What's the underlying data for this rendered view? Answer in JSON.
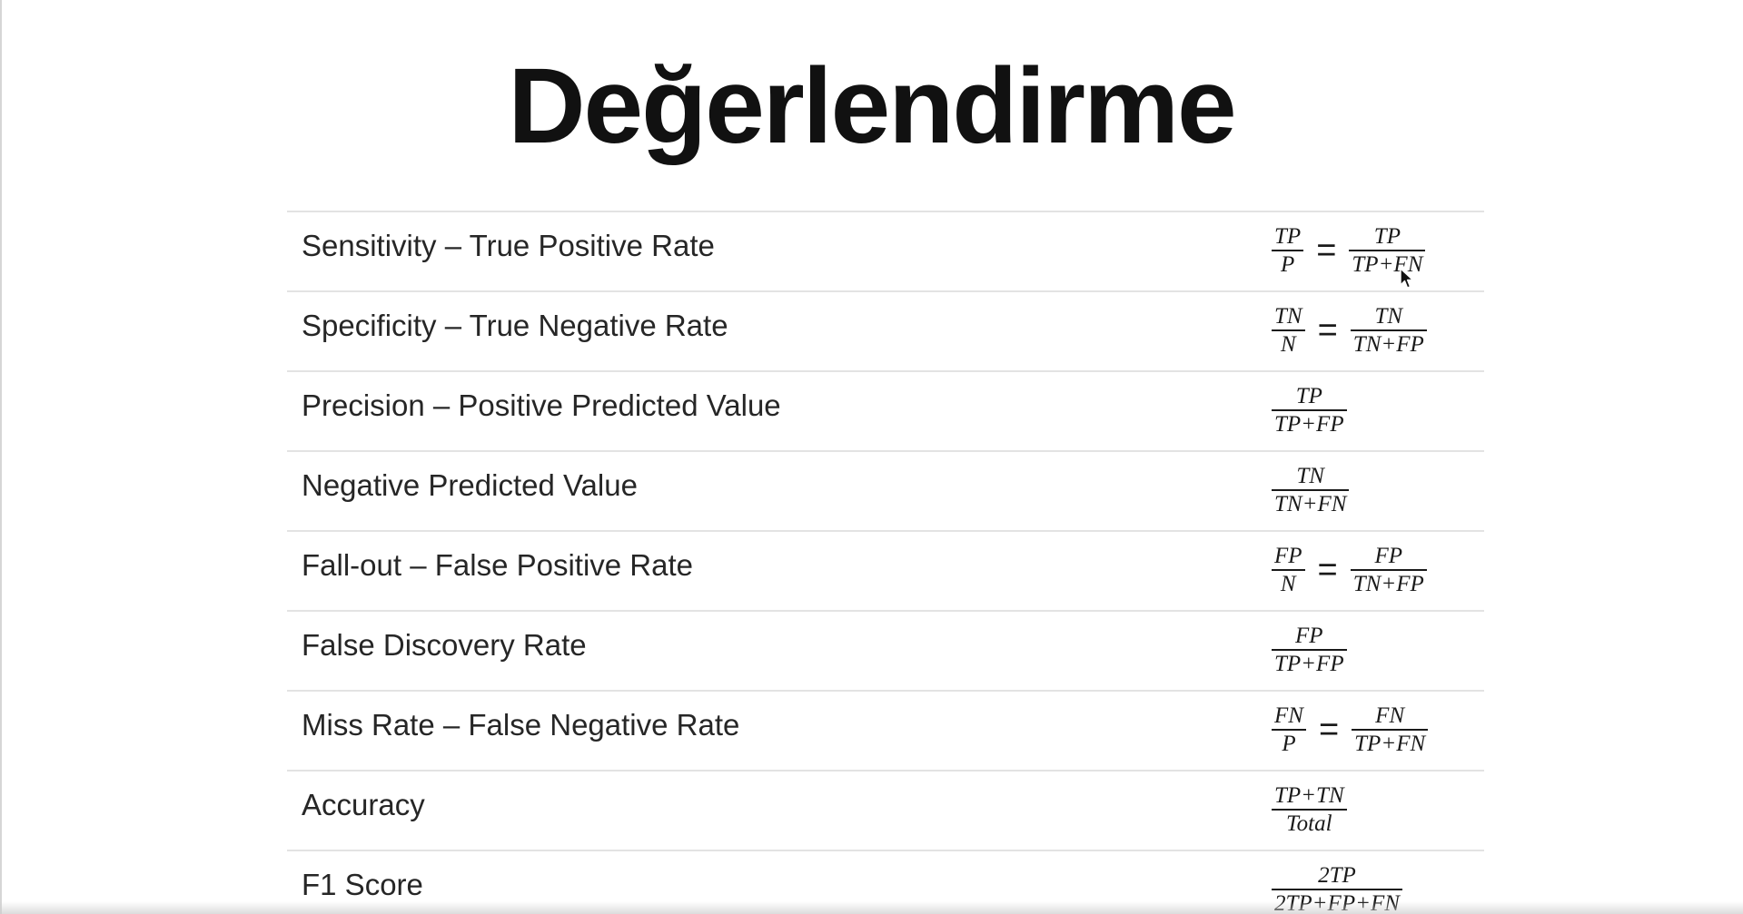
{
  "title": "Değerlendirme",
  "metrics": [
    {
      "name": "Sensitivity – True Positive Rate",
      "f1_num": "TP",
      "f1_den": "P",
      "f2_num": "TP",
      "f2_den": "TP+FN"
    },
    {
      "name": "Specificity – True Negative Rate",
      "f1_num": "TN",
      "f1_den": "N",
      "f2_num": "TN",
      "f2_den": "TN+FP"
    },
    {
      "name": "Precision – Positive Predicted Value",
      "f1_num": "TP",
      "f1_den": "TP+FP"
    },
    {
      "name": "Negative Predicted Value",
      "f1_num": "TN",
      "f1_den": "TN+FN"
    },
    {
      "name": "Fall-out – False Positive Rate",
      "f1_num": "FP",
      "f1_den": "N",
      "f2_num": "FP",
      "f2_den": "TN+FP"
    },
    {
      "name": "False Discovery Rate",
      "f1_num": "FP",
      "f1_den": "TP+FP"
    },
    {
      "name": "Miss Rate – False Negative Rate",
      "f1_num": "FN",
      "f1_den": "P",
      "f2_num": "FN",
      "f2_den": "TP+FN"
    },
    {
      "name": "Accuracy",
      "f1_num": "TP+TN",
      "f1_den": "Total"
    },
    {
      "name": "F1 Score",
      "f1_num": "2TP",
      "f1_den": "2TP+FP+FN"
    }
  ],
  "equals_sign": "="
}
